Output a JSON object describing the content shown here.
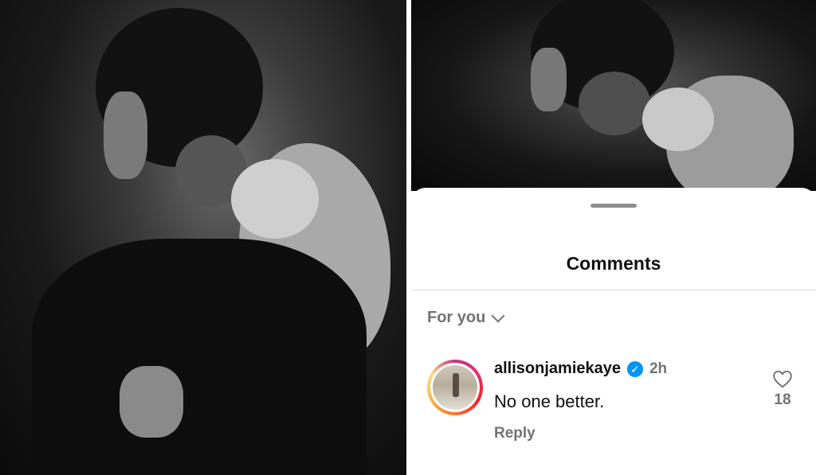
{
  "sheet": {
    "title": "Comments",
    "filter_label": "For you"
  },
  "comment": {
    "username": "allisonjamiekaye",
    "verified": true,
    "time": "2h",
    "text": "No one better.",
    "reply_label": "Reply",
    "like_count": "18"
  },
  "colors": {
    "verified_blue": "#0095f6",
    "secondary_text": "#737373",
    "primary_text": "#111111"
  },
  "icons": {
    "filter": "chevron-down-icon",
    "like": "heart-outline-icon",
    "verified": "verified-badge-icon"
  }
}
